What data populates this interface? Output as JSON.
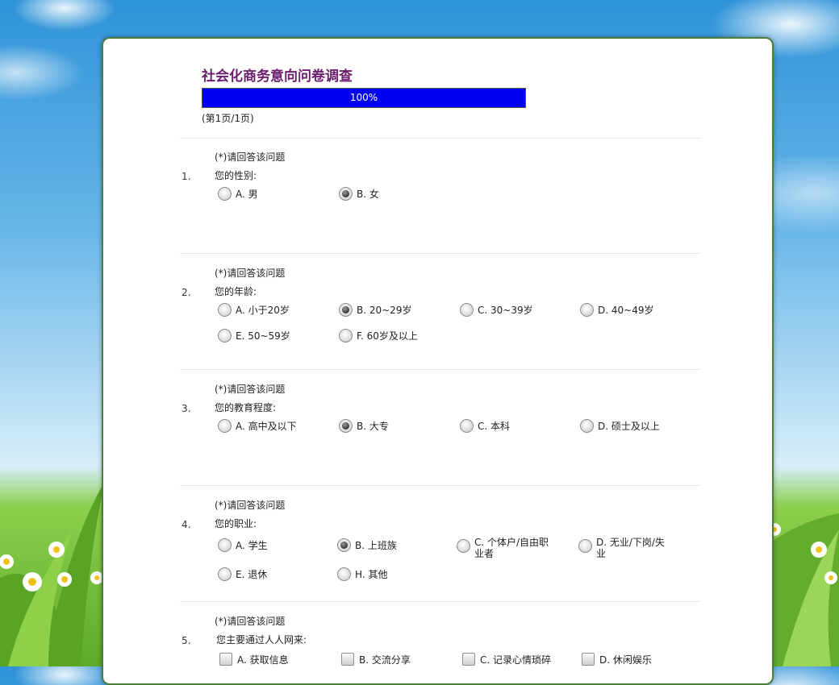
{
  "survey": {
    "title": "社会化商务意向问卷调查",
    "progress_text": "100%",
    "progress_value": 1.0,
    "page_info": "(第1页/1页)"
  },
  "questions": [
    {
      "number": "1.",
      "required": "(*)请回答该问题",
      "text": "您的性别:",
      "type": "radio",
      "options": [
        {
          "label": "A. 男",
          "checked": false
        },
        {
          "label": "B. 女",
          "checked": true
        }
      ]
    },
    {
      "number": "2.",
      "required": "(*)请回答该问题",
      "text": "您的年龄:",
      "type": "radio",
      "options": [
        {
          "label": "A. 小于20岁",
          "checked": false
        },
        {
          "label": "B. 20~29岁",
          "checked": true
        },
        {
          "label": "C. 30~39岁",
          "checked": false
        },
        {
          "label": "D. 40~49岁",
          "checked": false
        },
        {
          "label": "E. 50~59岁",
          "checked": false
        },
        {
          "label": "F. 60岁及以上",
          "checked": false
        }
      ]
    },
    {
      "number": "3.",
      "required": "(*)请回答该问题",
      "text": "您的教育程度:",
      "type": "radio",
      "options": [
        {
          "label": "A. 高中及以下",
          "checked": false
        },
        {
          "label": "B. 大专",
          "checked": true
        },
        {
          "label": "C. 本科",
          "checked": false
        },
        {
          "label": "D. 硕士及以上",
          "checked": false
        }
      ]
    },
    {
      "number": "4.",
      "required": "(*)请回答该问题",
      "text": "您的职业:",
      "type": "radio",
      "options": [
        {
          "label": "A. 学生",
          "checked": false
        },
        {
          "label": "B. 上班族",
          "checked": true
        },
        {
          "label": "C. 个体户/自由职业者",
          "checked": false
        },
        {
          "label": "D. 无业/下岗/失业",
          "checked": false
        },
        {
          "label": "E. 退休",
          "checked": false
        },
        {
          "label": "H. 其他",
          "checked": false
        }
      ]
    },
    {
      "number": "5.",
      "required": "(*)请回答该问题",
      "text": "您主要通过人人网来:",
      "type": "checkbox",
      "options": [
        {
          "label": "A. 获取信息",
          "checked": false
        },
        {
          "label": "B. 交流分享",
          "checked": false
        },
        {
          "label": "C. 记录心情琐碎",
          "checked": false
        },
        {
          "label": "D. 休闲娱乐",
          "checked": false
        }
      ]
    }
  ],
  "colors": {
    "title": "#6b1e6e",
    "progress_fill": "#0000f5",
    "panel_border": "#4c7d3b"
  }
}
